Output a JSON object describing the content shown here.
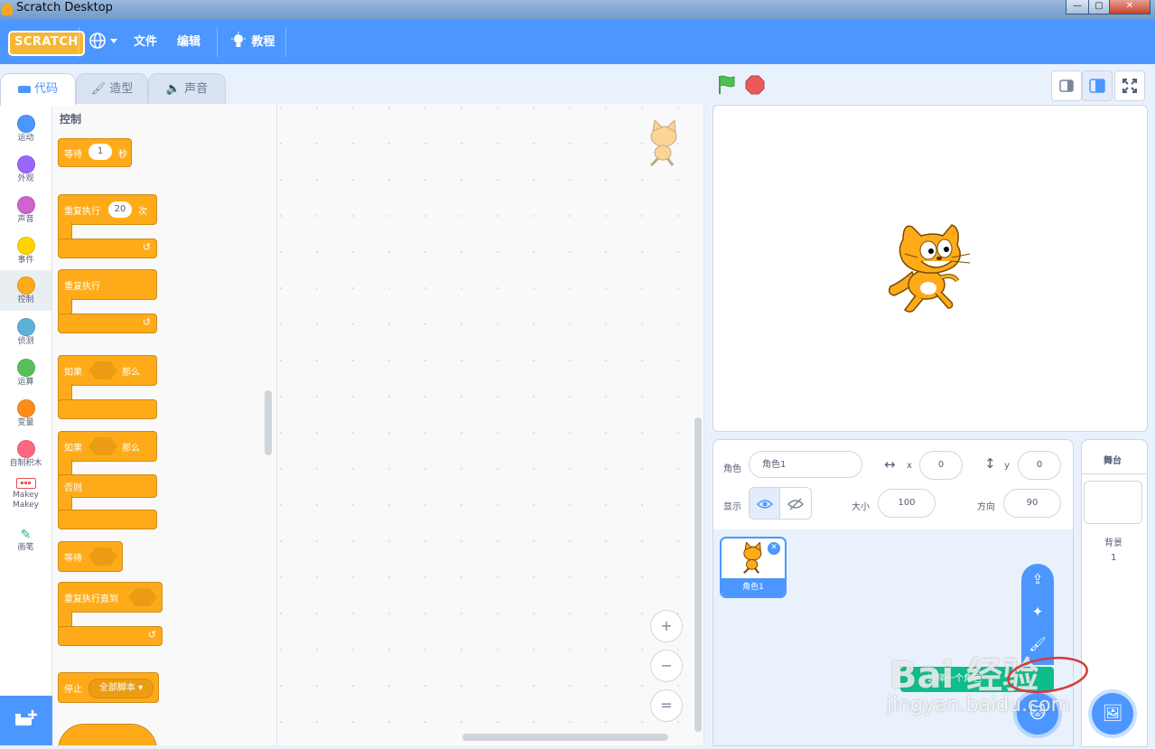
{
  "window": {
    "title": "Scratch Desktop",
    "min": "—",
    "max": "▢",
    "close": "✕"
  },
  "menubar": {
    "logo": "SCRATCH",
    "file": "文件",
    "edit": "编辑",
    "tutorials": "教程"
  },
  "tabs": [
    {
      "label": "代码"
    },
    {
      "label": "造型"
    },
    {
      "label": "声音"
    }
  ],
  "categories": [
    {
      "label": "运动",
      "color": "#4c97ff"
    },
    {
      "label": "外观",
      "color": "#9966ff"
    },
    {
      "label": "声音",
      "color": "#cf63cf"
    },
    {
      "label": "事件",
      "color": "#ffd500"
    },
    {
      "label": "控制",
      "color": "#ffab19"
    },
    {
      "label": "侦测",
      "color": "#5cb1d6"
    },
    {
      "label": "运算",
      "color": "#59c059"
    },
    {
      "label": "变量",
      "color": "#ff8c1a"
    },
    {
      "label": "自制积木",
      "color": "#ff6680"
    },
    {
      "label": "Makey Makey"
    },
    {
      "label": "画笔"
    }
  ],
  "palette": {
    "title": "控制",
    "wait": {
      "label": "等待",
      "value": "1",
      "unit": "秒"
    },
    "repeat": {
      "label": "重复执行",
      "value": "20",
      "unit": "次"
    },
    "forever": {
      "label": "重复执行"
    },
    "if_then": {
      "if": "如果",
      "then": "那么"
    },
    "if_else": {
      "if": "如果",
      "then": "那么",
      "else": "否则"
    },
    "wait_until": {
      "label": "等待"
    },
    "repeat_until": {
      "label": "重复执行直到"
    },
    "stop": {
      "label": "停止",
      "option": "全部脚本"
    }
  },
  "zoom": {
    "in": "+",
    "out": "−",
    "reset": "="
  },
  "sprite_info": {
    "sprite_label": "角色",
    "sprite_name": "角色1",
    "x_label": "x",
    "x_value": "0",
    "y_label": "y",
    "y_value": "0",
    "show_label": "显示",
    "size_label": "大小",
    "size_value": "100",
    "direction_label": "方向",
    "direction_value": "90"
  },
  "sprites": [
    {
      "name": "角色1"
    }
  ],
  "sprite_menu": {
    "tooltip": "选择一个角色"
  },
  "stage_pane": {
    "title": "舞台",
    "backdrops_label": "背景",
    "backdrops_count": "1"
  },
  "watermark": {
    "text": "Bai 经验",
    "url": "jingyan.baidu.com"
  }
}
